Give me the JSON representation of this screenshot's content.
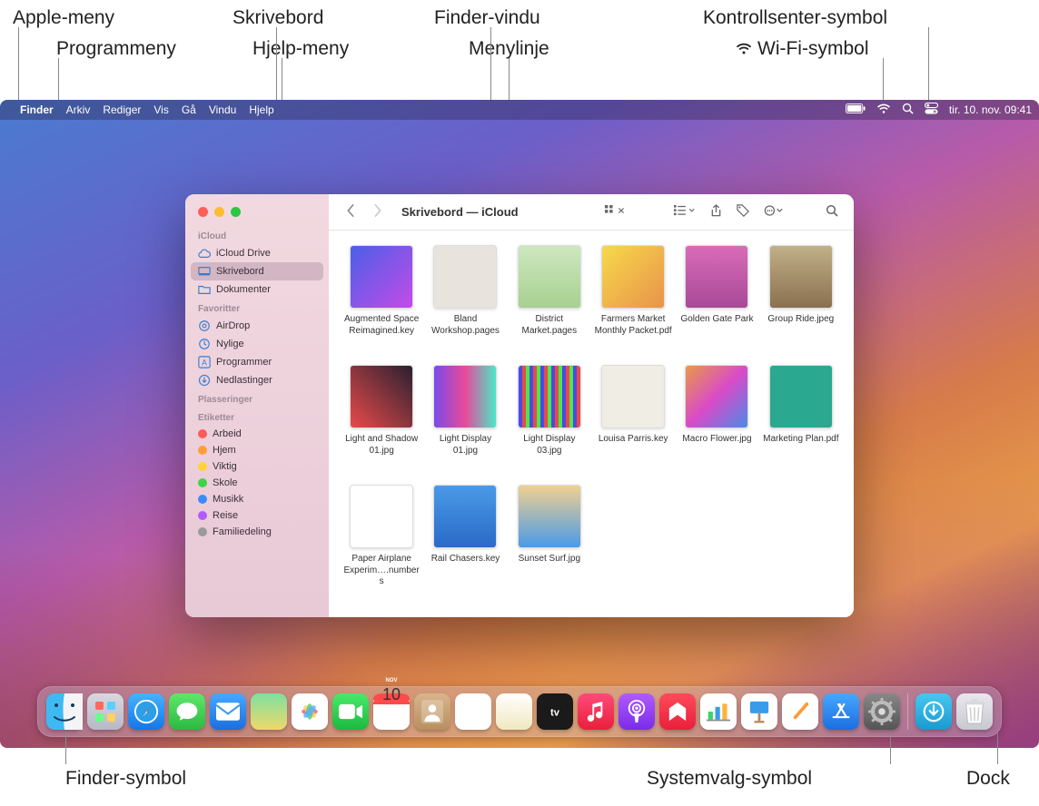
{
  "callouts": {
    "top": [
      "Apple-meny",
      "Skrivebord",
      "Finder-vindu",
      "Kontrollsenter-symbol",
      "Programmeny",
      "Hjelp-meny",
      "Menylinje",
      "Wi-Fi-symbol"
    ],
    "bottom": [
      "Finder-symbol",
      "Systemvalg-symbol",
      "Dock"
    ]
  },
  "menubar": {
    "appName": "Finder",
    "items": [
      "Arkiv",
      "Rediger",
      "Vis",
      "Gå",
      "Vindu",
      "Hjelp"
    ],
    "dateTime": "tir. 10. nov.  09:41"
  },
  "finder": {
    "title": "Skrivebord — iCloud",
    "sidebar": {
      "sections": [
        {
          "label": "iCloud",
          "items": [
            {
              "icon": "cloud",
              "label": "iCloud Drive"
            },
            {
              "icon": "desktop",
              "label": "Skrivebord",
              "selected": true
            },
            {
              "icon": "folder",
              "label": "Dokumenter"
            }
          ]
        },
        {
          "label": "Favoritter",
          "items": [
            {
              "icon": "airdrop",
              "label": "AirDrop"
            },
            {
              "icon": "clock",
              "label": "Nylige"
            },
            {
              "icon": "apps",
              "label": "Programmer"
            },
            {
              "icon": "download",
              "label": "Nedlastinger"
            }
          ]
        },
        {
          "label": "Plasseringer",
          "items": []
        },
        {
          "label": "Etiketter",
          "items": [
            {
              "tag": "#ff5b5b",
              "label": "Arbeid"
            },
            {
              "tag": "#ff9f3b",
              "label": "Hjem"
            },
            {
              "tag": "#ffd23b",
              "label": "Viktig"
            },
            {
              "tag": "#3fd24a",
              "label": "Skole"
            },
            {
              "tag": "#3b8bff",
              "label": "Musikk"
            },
            {
              "tag": "#b15bff",
              "label": "Reise"
            },
            {
              "tag": "#9a9a9a",
              "label": "Familiedeling"
            }
          ]
        }
      ]
    },
    "files": [
      {
        "name": "Augmented Space Reimagined.key",
        "thumb": "th0"
      },
      {
        "name": "Bland Workshop.pages",
        "thumb": "th1"
      },
      {
        "name": "District Market.pages",
        "thumb": "th2"
      },
      {
        "name": "Farmers Market Monthly Packet.pdf",
        "thumb": "th3"
      },
      {
        "name": "Golden Gate Park",
        "thumb": "th4"
      },
      {
        "name": "Group Ride.jpeg",
        "thumb": "th5"
      },
      {
        "name": "Light and Shadow 01.jpg",
        "thumb": "th6"
      },
      {
        "name": "Light Display 01.jpg",
        "thumb": "th7"
      },
      {
        "name": "Light Display 03.jpg",
        "thumb": "th8"
      },
      {
        "name": "Louisa Parris.key",
        "thumb": "th9"
      },
      {
        "name": "Macro Flower.jpg",
        "thumb": "th10"
      },
      {
        "name": "Marketing Plan.pdf",
        "thumb": "th11"
      },
      {
        "name": "Paper Airplane Experim….numbers",
        "thumb": "th12"
      },
      {
        "name": "Rail Chasers.key",
        "thumb": "th13"
      },
      {
        "name": "Sunset Surf.jpg",
        "thumb": "th14"
      }
    ]
  },
  "dock": {
    "calendarDay": "10",
    "calendarMonth": "NOV",
    "apps": [
      {
        "name": "Finder",
        "bg": "linear-gradient(#5ec7f5,#1b8ae0)"
      },
      {
        "name": "Launchpad",
        "bg": "linear-gradient(#d8d8e0,#b8b8c8)"
      },
      {
        "name": "Safari",
        "bg": "linear-gradient(#46b3ff,#1576e8)"
      },
      {
        "name": "Messages",
        "bg": "linear-gradient(#5ee86a,#2bb940)"
      },
      {
        "name": "Mail",
        "bg": "linear-gradient(#46a8ff,#1b6ee0)"
      },
      {
        "name": "Maps",
        "bg": "linear-gradient(#7ee0a0,#f0d86a)"
      },
      {
        "name": "Photos",
        "bg": "#fff"
      },
      {
        "name": "FaceTime",
        "bg": "linear-gradient(#4ae86a,#1bb940)"
      },
      {
        "name": "Calendar",
        "bg": "#fff"
      },
      {
        "name": "Contacts",
        "bg": "linear-gradient(#d8b48a,#b89060)"
      },
      {
        "name": "Reminders",
        "bg": "#fff"
      },
      {
        "name": "Notes",
        "bg": "linear-gradient(#fff,#f0e8c0)"
      },
      {
        "name": "TV",
        "bg": "#1a1a1a"
      },
      {
        "name": "Music",
        "bg": "linear-gradient(#ff4a7a,#e8203a)"
      },
      {
        "name": "Podcasts",
        "bg": "linear-gradient(#b15bff,#7a2be8)"
      },
      {
        "name": "News",
        "bg": "linear-gradient(#ff4a5a,#e8203a)"
      },
      {
        "name": "Numbers",
        "bg": "#fff"
      },
      {
        "name": "Keynote",
        "bg": "#fff"
      },
      {
        "name": "Pages",
        "bg": "#fff"
      },
      {
        "name": "AppStore",
        "bg": "linear-gradient(#46a8ff,#1b6ee0)"
      },
      {
        "name": "SystemPreferences",
        "bg": "linear-gradient(#888,#555)"
      }
    ],
    "right": [
      {
        "name": "Downloads",
        "bg": "linear-gradient(#46c8f0,#1b9ad0)"
      },
      {
        "name": "Trash",
        "bg": "linear-gradient(#e8e8ec,#c8c8d0)"
      }
    ]
  }
}
